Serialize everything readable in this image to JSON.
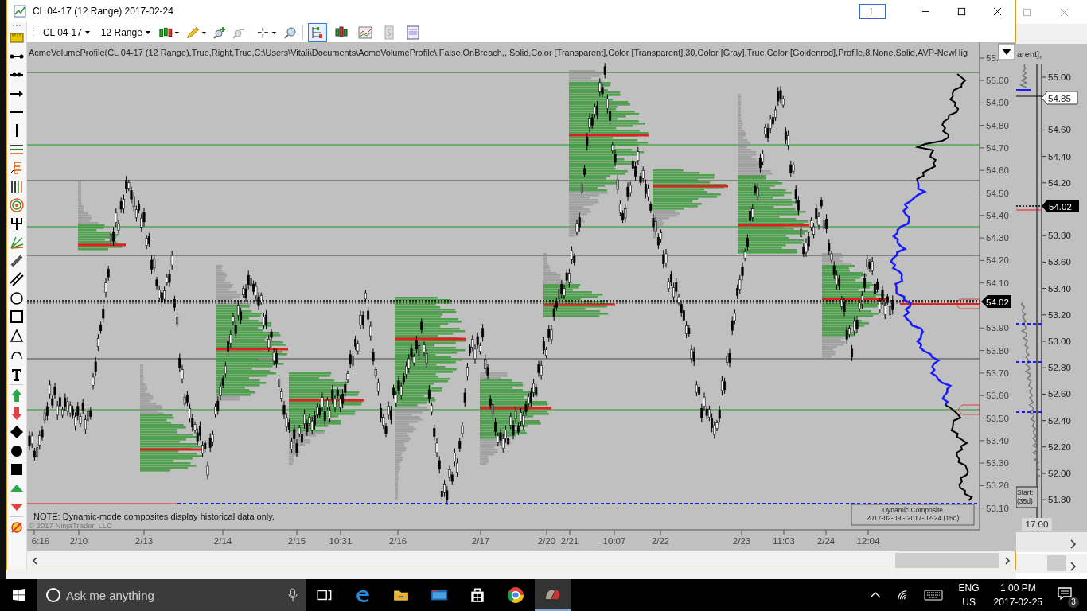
{
  "window": {
    "title": "CL 04-17 (12 Range)  2017-02-24",
    "account_button": "L"
  },
  "toolbar": {
    "instrument": "CL 04-17",
    "interval": "12 Range",
    "chart_tools": [
      {
        "selected": true
      },
      {
        "selected": false
      },
      {
        "selected": false
      },
      {
        "selected": false
      },
      {
        "selected": false
      }
    ]
  },
  "chart": {
    "indicator_label": "AcmeVolumeProfile(CL 04-17 (12 Range),True,Right,True,C:\\Users\\Vitali\\Documents\\AcmeVolumeProfile\\,False,OnBreach,,,Solid,Color [Transparent],Color [Transparent],30,Color [Gray],True,Color [Goldenrod],Profile,8,None,Solid,AVP-NewHig",
    "note": "NOTE: Dynamic-mode composites display historical data only.",
    "copyright": "© 2017 NinjaTrader, LLC",
    "price_labels": [
      "55.",
      "55.00",
      "54.90",
      "54.80",
      "54.70",
      "54.60",
      "54.50",
      "54.40",
      "54.30",
      "54.20",
      "54.10",
      "53.90",
      "53.80",
      "53.70",
      "53.60",
      "53.50",
      "53.40",
      "53.30",
      "53.20",
      "53.10"
    ],
    "last_price": "54.02",
    "time_labels": [
      "6:16",
      "2/10",
      "2/13",
      "2/14",
      "2/15",
      "10:31",
      "2/16",
      "2/17",
      "2/20",
      "2/21",
      "10:07",
      "2/22",
      "2/23",
      "11:03",
      "2/24",
      "12:04"
    ],
    "composite": {
      "title": "Dynamic Composite",
      "range": "2017-02-09 - 2017-02-24 (15d)"
    }
  },
  "background_window": {
    "label_fragment": "arent],",
    "price_labels": [
      "55.00",
      "54.60",
      "54.40",
      "54.20",
      "53.80",
      "53.60",
      "53.40",
      "53.20",
      "53.00",
      "52.80",
      "52.60",
      "52.40",
      "52.20",
      "52.00",
      "51.80"
    ],
    "marker_price": "54.85",
    "last_price": "54.02",
    "box_lines": [
      "Start:",
      "(35d)"
    ],
    "time_label": "17:00"
  },
  "taskbar": {
    "search_placeholder": "Ask me anything",
    "language": "ENG",
    "region": "US",
    "time": "1:00 PM",
    "date": "2017-02-25",
    "notifications": "3"
  }
}
